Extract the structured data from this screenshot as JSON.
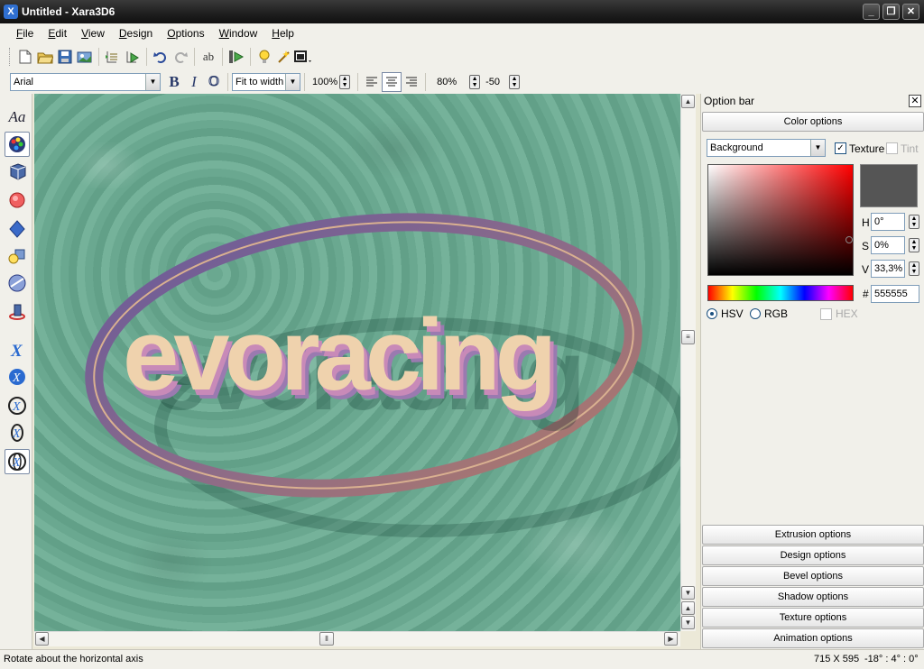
{
  "window": {
    "title": "Untitled - Xara3D6",
    "minimize": "_",
    "restore": "❐",
    "close": "✕"
  },
  "menu": [
    {
      "label": "File",
      "key": "F",
      "rest": "ile"
    },
    {
      "label": "Edit",
      "key": "E",
      "rest": "dit"
    },
    {
      "label": "View",
      "key": "V",
      "rest": "iew"
    },
    {
      "label": "Design",
      "key": "D",
      "rest": "esign"
    },
    {
      "label": "Options",
      "key": "O",
      "rest": "ptions"
    },
    {
      "label": "Window",
      "key": "W",
      "rest": "indow"
    },
    {
      "label": "Help",
      "key": "H",
      "rest": "elp"
    }
  ],
  "toolbar2": {
    "font": "Arial",
    "bold": "B",
    "italic": "I",
    "outline": "O",
    "zoom_mode": "Fit to width",
    "zoom_percent": "100%",
    "line_spacing": "80%",
    "char_spacing": "-50"
  },
  "canvas": {
    "text": "evoracing"
  },
  "panel": {
    "title": "Option bar",
    "color_options": "Color options",
    "target": "Background",
    "texture_label": "Texture",
    "texture_checked": true,
    "tint_label": "Tint",
    "h_label": "H",
    "h_value": "0°",
    "s_label": "S",
    "s_value": "0%",
    "v_label": "V",
    "v_value": "33,3%",
    "hash_label": "#",
    "hex_value": "555555",
    "swatch_color": "#555555",
    "hsv_label": "HSV",
    "rgb_label": "RGB",
    "hex_label": "HEX",
    "sections": [
      "Extrusion options",
      "Design options",
      "Bevel options",
      "Shadow options",
      "Texture options",
      "Animation options"
    ]
  },
  "status": {
    "hint": "Rotate about the horizontal axis",
    "size": "715 X 595",
    "angles": "-18° : 4° : 0°"
  }
}
